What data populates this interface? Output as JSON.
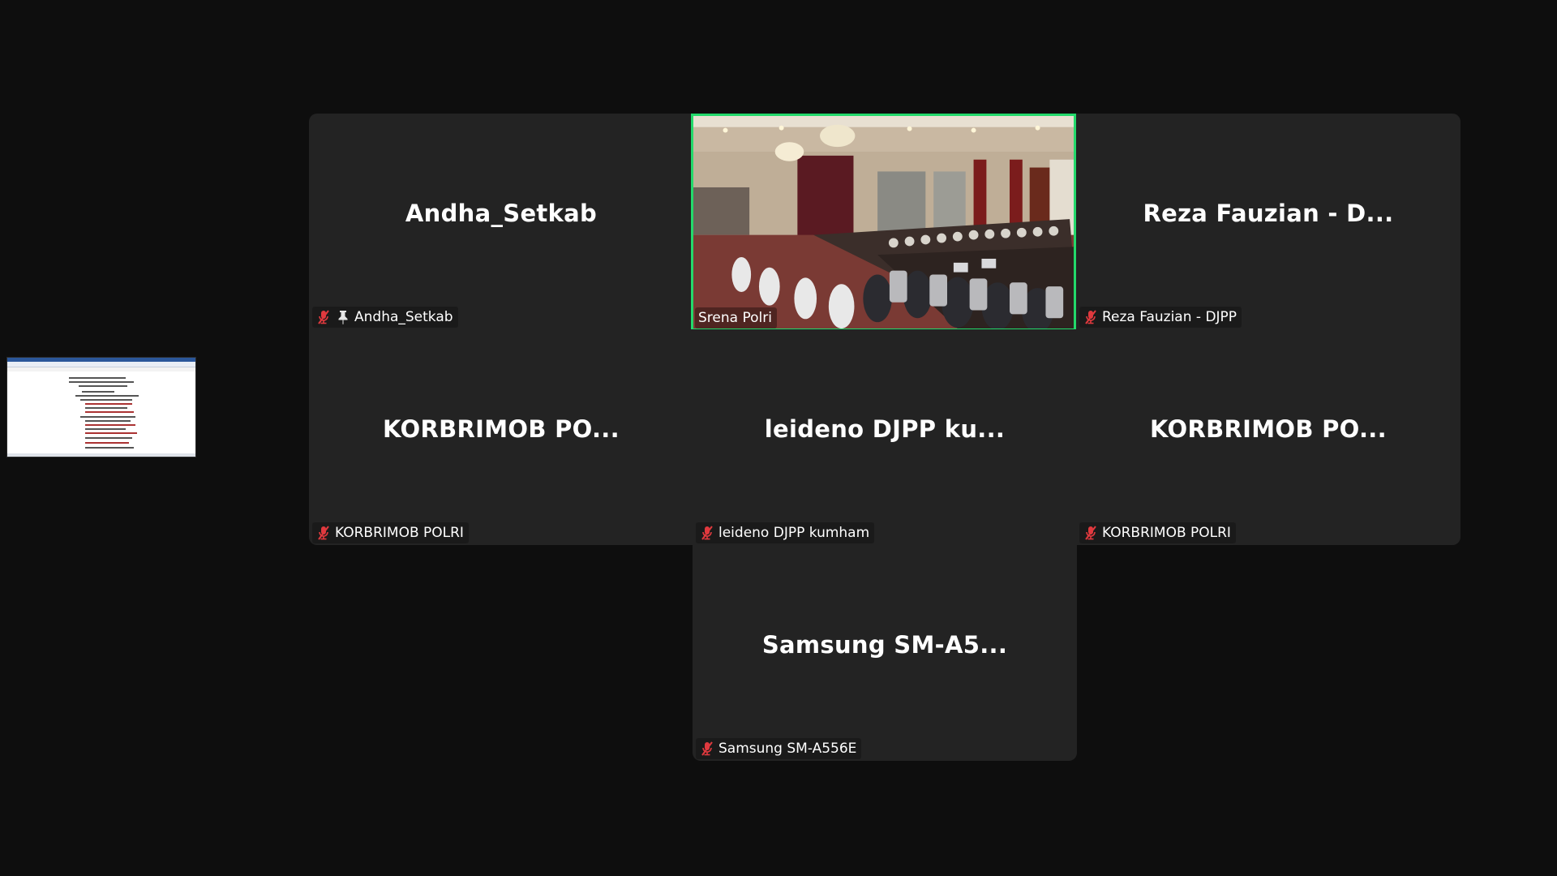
{
  "shared_screen": {
    "icon": "document-thumbnail"
  },
  "colors": {
    "background": "#0e0e0e",
    "tile": "#232323",
    "active_speaker_border": "#23d96b",
    "muted_icon": "#e0393e"
  },
  "tiles": [
    {
      "display_name": "Andha_Setkab",
      "label": "Andha_Setkab",
      "muted": true,
      "pinned": true
    },
    {
      "display_name": "",
      "label": "Srena Polri",
      "muted": false,
      "video": true,
      "active_speaker": true
    },
    {
      "display_name": "Reza Fauzian - D...",
      "label": "Reza Fauzian - DJPP",
      "muted": true
    },
    {
      "display_name": "KORBRIMOB PO...",
      "label": "KORBRIMOB POLRI",
      "muted": true
    },
    {
      "display_name": "leideno DJPP ku...",
      "label": "leideno DJPP kumham",
      "muted": true
    },
    {
      "display_name": "KORBRIMOB PO...",
      "label": "KORBRIMOB POLRI",
      "muted": true
    },
    {
      "display_name": "Samsung SM-A5...",
      "label": "Samsung SM-A556E",
      "muted": true
    }
  ]
}
